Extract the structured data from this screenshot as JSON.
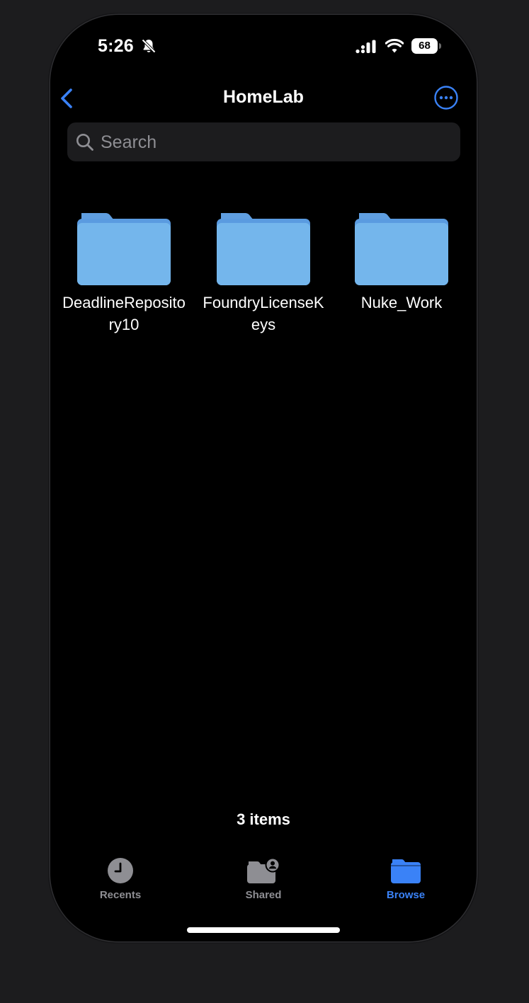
{
  "status_bar": {
    "time": "5:26",
    "battery": "68",
    "icons": [
      "bell-slash-icon",
      "cellular-signal-icon",
      "wifi-icon",
      "battery-icon"
    ]
  },
  "nav": {
    "title": "HomeLab",
    "back_icon": "chevron-left-icon",
    "more_icon": "ellipsis-circle-icon"
  },
  "search": {
    "placeholder": "Search",
    "value": "",
    "icon": "magnifying-glass-icon"
  },
  "folders": [
    {
      "name": "DeadlineRepository10",
      "icon": "folder-icon"
    },
    {
      "name": "FoundryLicenseKeys",
      "icon": "folder-icon"
    },
    {
      "name": "Nuke_Work",
      "icon": "folder-icon"
    }
  ],
  "footer": {
    "items_count": "3 items"
  },
  "tab_bar": {
    "tabs": [
      {
        "label": "Recents",
        "icon": "clock-icon",
        "active": false
      },
      {
        "label": "Shared",
        "icon": "shared-folder-icon",
        "active": false
      },
      {
        "label": "Browse",
        "icon": "folder-icon",
        "active": true
      }
    ]
  },
  "colors": {
    "accent": "#3a82f7",
    "background": "#000000",
    "folder_blue": "#74b6ec",
    "inactive_tab": "#8e8e93"
  }
}
